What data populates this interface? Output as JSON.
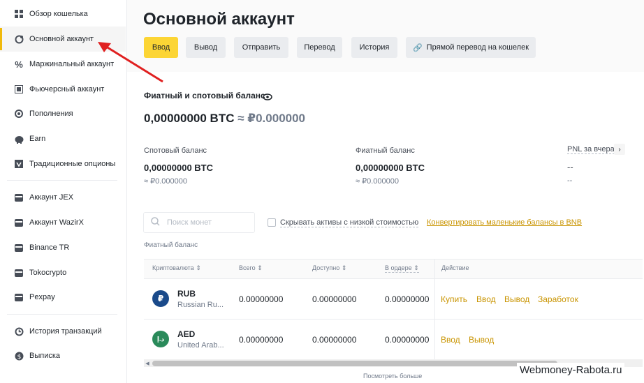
{
  "sidebar": {
    "items": [
      {
        "label": "Обзор кошелька",
        "icon": "grid-icon"
      },
      {
        "label": "Основной аккаунт",
        "icon": "wallet-icon"
      },
      {
        "label": "Маржинальный аккаунт",
        "icon": "percent-icon"
      },
      {
        "label": "Фьючерсный аккаунт",
        "icon": "futures-icon"
      },
      {
        "label": "Пополнения",
        "icon": "dot-icon"
      },
      {
        "label": "Earn",
        "icon": "pig-icon"
      },
      {
        "label": "Традиционные опционы",
        "icon": "options-icon"
      },
      {
        "label": "Аккаунт JEX",
        "icon": "card-icon"
      },
      {
        "label": "Аккаунт WazirX",
        "icon": "card-icon"
      },
      {
        "label": "Binance TR",
        "icon": "card-icon"
      },
      {
        "label": "Tokocrypto",
        "icon": "card-icon"
      },
      {
        "label": "Pexpay",
        "icon": "card-icon"
      },
      {
        "label": "История транзакций",
        "icon": "history-icon"
      },
      {
        "label": "Выписка",
        "icon": "dollar-icon"
      }
    ]
  },
  "header": {
    "title": "Основной аккаунт",
    "buttons": {
      "deposit": "Ввод",
      "withdraw": "Вывод",
      "send": "Отправить",
      "transfer": "Перевод",
      "history": "История",
      "direct": "Прямой перевод на кошелек"
    }
  },
  "balance": {
    "heading": "Фиатный и спотовый баланс",
    "total_btc": "0,00000000 BTC",
    "total_rub": "≈ ₽0.000000",
    "spot_label": "Спотовый баланс",
    "spot_btc": "0,00000000 BTC",
    "spot_rub": "≈ ₽0.000000",
    "fiat_label": "Фиатный баланс",
    "fiat_btc": "0,00000000 BTC",
    "fiat_rub": "≈ ₽0.000000",
    "pnl_label": "PNL за вчера",
    "pnl_value": "--",
    "pnl_sub": "--"
  },
  "filters": {
    "search_placeholder": "Поиск монет",
    "hide_small": "Скрывать активы с низкой стоимостью",
    "convert_link": "Конвертировать маленькие балансы в BNB",
    "section_label": "Фиатный баланс"
  },
  "table": {
    "headers": {
      "coin": "Криптовалюта",
      "total": "Всего",
      "available": "Доступно",
      "in_order": "В ордере",
      "action": "Действие"
    },
    "rows": [
      {
        "symbol": "RUB",
        "name": "Russian Ru...",
        "glyph": "₽",
        "color": "#1a4a8a",
        "total": "0.00000000",
        "available": "0.00000000",
        "in_order": "0.00000000",
        "actions": [
          "Купить",
          "Ввод",
          "Вывод",
          "Заработок"
        ]
      },
      {
        "symbol": "AED",
        "name": "United Arab...",
        "glyph": "د.إ",
        "color": "#2a8a5a",
        "total": "0.00000000",
        "available": "0.00000000",
        "in_order": "0.00000000",
        "actions": [
          "Ввод",
          "Вывод"
        ]
      }
    ],
    "see_more": "Посмотреть больше"
  },
  "watermark": "Webmoney-Rabota.ru",
  "colors": {
    "accent": "#fcd535",
    "link": "#c99400",
    "arrow": "#e02020"
  }
}
